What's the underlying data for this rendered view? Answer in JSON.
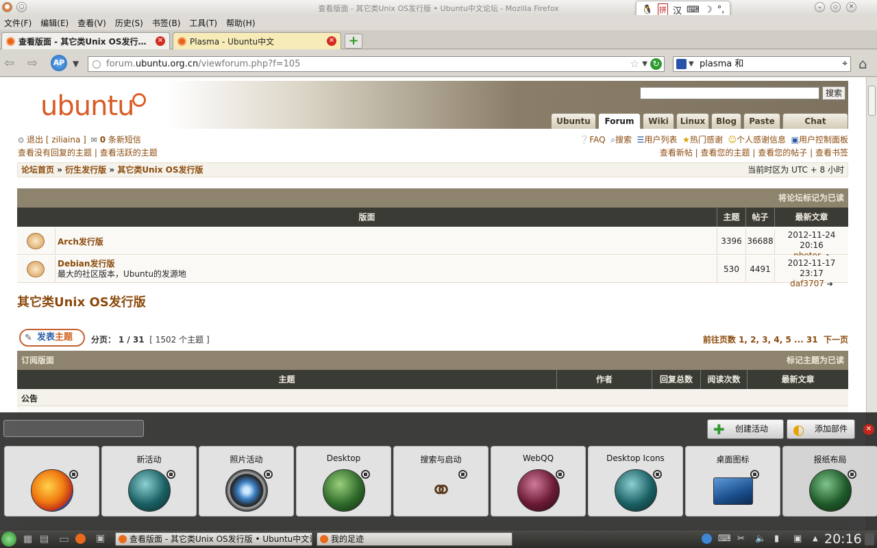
{
  "window": {
    "title": "查看版面 - 其它类Unix OS发行版 • Ubuntu中文论坛 - Mozilla Firefox"
  },
  "ime": {
    "items": [
      "🐧",
      "拼",
      "汉",
      "⌨",
      "☽",
      "°,"
    ]
  },
  "menu": [
    "文件(F)",
    "编辑(E)",
    "查看(V)",
    "历史(S)",
    "书签(B)",
    "工具(T)",
    "帮助(H)"
  ],
  "tabs": [
    {
      "label": "查看版面 - 其它类Unix OS发行…"
    },
    {
      "label": "Plasma - Ubuntu中文"
    }
  ],
  "nav": {
    "url_prefix": "forum.",
    "url_host": "ubuntu.org.cn",
    "url_path": "/viewforum.php?f=105",
    "search_value": "plasma 和"
  },
  "header": {
    "logo": "ubuntu",
    "search_button": "搜索",
    "nav_tabs": [
      "Ubuntu",
      "Forum",
      "Wiki",
      "Linux",
      "Blog",
      "Paste",
      "Chat"
    ]
  },
  "userbar": {
    "logout": "退出 [ ziliaina ]",
    "messages_count": "0",
    "messages_label": " 条新短信",
    "unanswered": "查看没有回复的主题",
    "active": "查看活跃的主题",
    "right_links": [
      "FAQ",
      "搜索",
      "用户列表",
      "热门感谢",
      "个人感谢信息",
      "用户控制面板"
    ],
    "right_links2": [
      "查看新帖",
      "查看您的主题",
      "查看您的帖子",
      "查看书签"
    ]
  },
  "breadcrumb": {
    "items": [
      "论坛首页",
      "衍生发行版",
      "其它类Unix OS发行版"
    ],
    "timezone": "当前时区为 UTC + 8 小时"
  },
  "forums": {
    "mark_read": "将论坛标记为已读",
    "headers": [
      "版面",
      "主题",
      "帖子",
      "最新文章"
    ],
    "rows": [
      {
        "name": "Arch发行版",
        "desc": "",
        "topics": "3396",
        "posts": "36688",
        "last_date": "2012-11-24 20:16",
        "last_user": "photor"
      },
      {
        "name": "Debian发行版",
        "desc": "最大的社区版本，Ubuntu的发源地",
        "topics": "530",
        "posts": "4491",
        "last_date": "2012-11-17 23:17",
        "last_user": "daf3707"
      }
    ]
  },
  "page_title": "其它类Unix OS发行版",
  "post_button": {
    "a": "发表",
    "b": "主题"
  },
  "pagination": {
    "label": "分页：",
    "value": "1 / 31",
    "count": "[ 1502 个主题 ]",
    "goto": "前往页数",
    "pages": [
      "1",
      "2",
      "3",
      "4",
      "5",
      "...",
      "31"
    ],
    "next": "下一页"
  },
  "topics": {
    "subscribe": "订阅版面",
    "mark": "标记主题为已读",
    "headers": [
      "主题",
      "作者",
      "回复总数",
      "阅读次数",
      "最新文章"
    ],
    "announce": "公告"
  },
  "dashboard": {
    "create_activity": "创建活动",
    "add_widget": "添加部件",
    "activities": [
      "",
      "新活动",
      "照片活动",
      "Desktop",
      "搜索与启动",
      "WebQQ",
      "Desktop Icons",
      "桌面图标",
      "报纸布局"
    ]
  },
  "taskbar": {
    "tasks": [
      "查看版面 - 其它类Unix OS发行版 • Ubuntu中文论",
      "我的足迹"
    ],
    "clock": "20:16"
  }
}
